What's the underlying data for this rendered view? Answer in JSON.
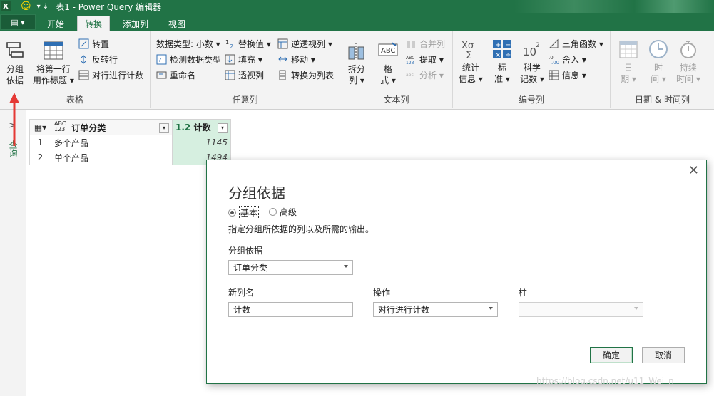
{
  "titlebar": {
    "logo": "X",
    "title": "表1 - Power Query 编辑器",
    "qa_icons": [
      "smiley-icon",
      "undo-icon"
    ]
  },
  "tabs": {
    "file": "▤ ▾",
    "items": [
      "开始",
      "转换",
      "添加列",
      "视图"
    ],
    "active": "转换"
  },
  "ribbon": {
    "table_group": {
      "label": "表格",
      "group_by": [
        "分组",
        "依据"
      ],
      "first_row": [
        "将第一行",
        "用作标题 ▾"
      ],
      "transpose": "转置",
      "reverse": "反转行",
      "count_rows": "对行进行计数"
    },
    "any_col_group": {
      "label": "任意列",
      "data_type": "数据类型: 小数 ▾",
      "detect": "检测数据类型",
      "rename": "重命名",
      "replace": "替换值 ▾",
      "fill": "填充 ▾",
      "pivot": "透视列",
      "unpivot": "逆透视列 ▾",
      "move": "移动 ▾",
      "to_list": "转换为列表"
    },
    "text_col_group": {
      "label": "文本列",
      "split": [
        "拆分",
        "列 ▾"
      ],
      "format": [
        "格",
        "式 ▾"
      ],
      "merge": "合并列",
      "extract": "提取 ▾",
      "parse": "分析 ▾"
    },
    "num_col_group": {
      "label": "编号列",
      "stats": [
        "统计",
        "信息 ▾"
      ],
      "standard": [
        "标",
        "准 ▾"
      ],
      "sci": [
        "科学",
        "记数 ▾"
      ],
      "trig": "三角函数 ▾",
      "round": "舍入 ▾",
      "info": "信息 ▾"
    },
    "datetime_group": {
      "label": "日期 & 时间列",
      "date": [
        "日",
        "期 ▾"
      ],
      "time": [
        "时",
        "间 ▾"
      ],
      "duration": [
        "持续",
        "时间 ▾"
      ]
    }
  },
  "side_pane": {
    "label": "查询",
    "chevron": ">"
  },
  "grid": {
    "columns": [
      {
        "type": "ABC\n123",
        "name": "订单分类"
      },
      {
        "type": "1.2",
        "name": "计数"
      }
    ],
    "rows": [
      {
        "n": "1",
        "cat": "多个产品",
        "count": "1145"
      },
      {
        "n": "2",
        "cat": "单个产品",
        "count": "1494"
      }
    ]
  },
  "dialog": {
    "title": "分组依据",
    "close": "✕",
    "mode_basic": "基本",
    "mode_advanced": "高级",
    "desc": "指定分组所依据的列以及所需的输出。",
    "group_label": "分组依据",
    "group_value": "订单分类",
    "newcol_label": "新列名",
    "newcol_value": "计数",
    "op_label": "操作",
    "op_value": "对行进行计数",
    "col_label": "柱",
    "col_value": "",
    "ok": "确定",
    "cancel": "取消"
  },
  "watermark": "https://blog.csdn.net/u11_Wei_n",
  "colors": {
    "brand": "#217346",
    "arrow": "#e53935"
  }
}
